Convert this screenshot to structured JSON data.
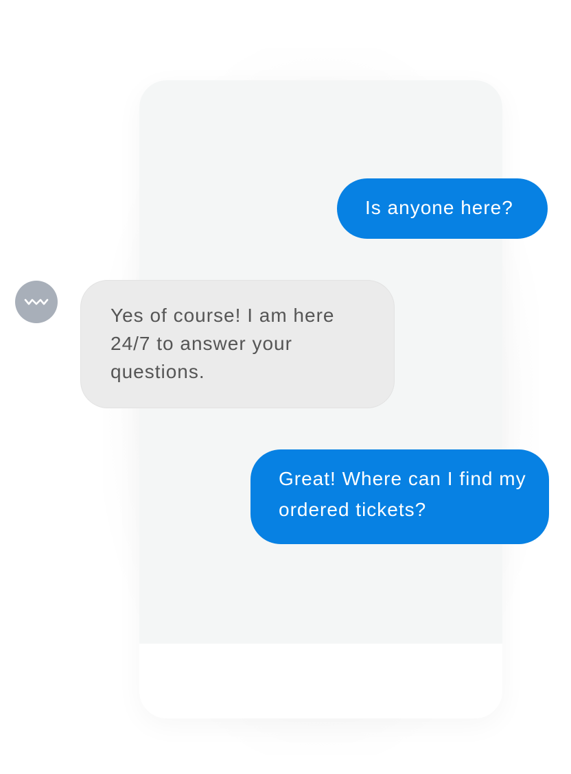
{
  "messages": [
    {
      "sender": "user",
      "text": "Is anyone here?"
    },
    {
      "sender": "bot",
      "text": "Yes of course! I am here 24/7 to answer your questions."
    },
    {
      "sender": "user",
      "text": "Great! Where can I find my ordered tickets?"
    }
  ],
  "bot_avatar_icon": "wave-logo-icon",
  "colors": {
    "user_bubble": "#0781e3",
    "bot_bubble": "#ebebeb",
    "avatar": "#a8afb9",
    "screen": "#f4f6f6"
  }
}
